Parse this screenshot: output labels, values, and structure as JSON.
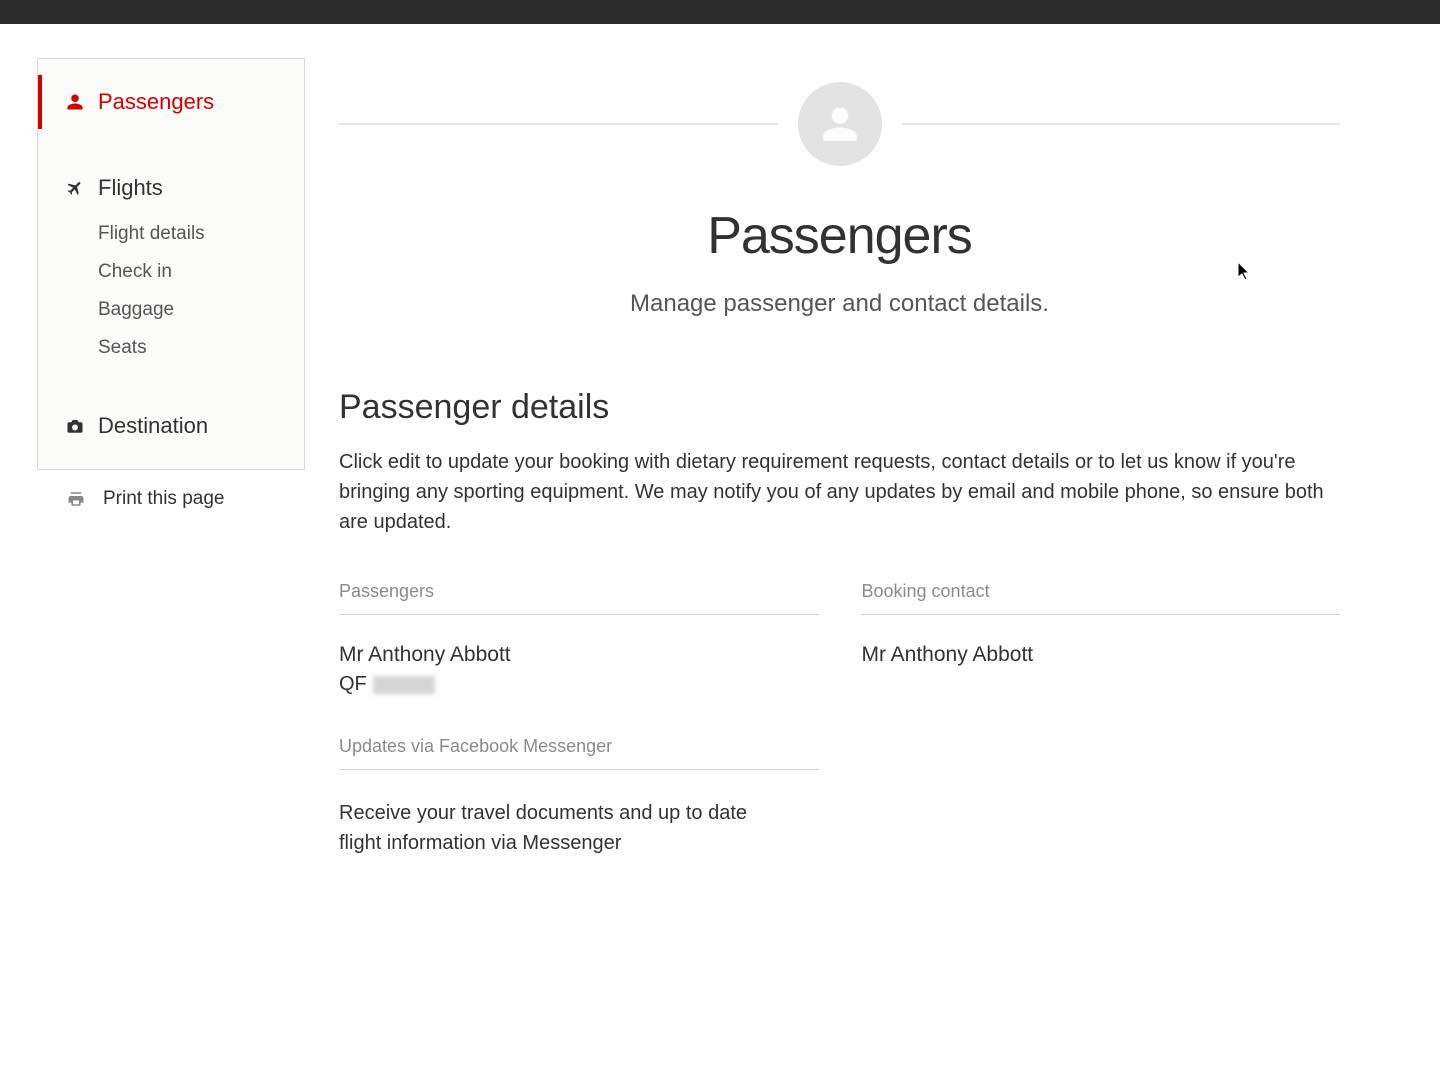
{
  "sidebar": {
    "passengers_label": "Passengers",
    "flights_label": "Flights",
    "flights_sub": {
      "flight_details": "Flight details",
      "check_in": "Check in",
      "baggage": "Baggage",
      "seats": "Seats"
    },
    "destination_label": "Destination",
    "print_label": "Print this page"
  },
  "main": {
    "title": "Passengers",
    "subtitle": "Manage passenger and contact details.",
    "section_title": "Passenger details",
    "section_desc": "Click edit to update your booking with dietary requirement requests, contact details or to let us know if you're bringing any sporting equipment. We may notify you of any updates by email and mobile phone, so ensure both are updated.",
    "passengers_header": "Passengers",
    "booking_contact_header": "Booking contact",
    "passenger_name": "Mr Anthony Abbott",
    "passenger_code_prefix": "QF",
    "booking_contact_name": "Mr Anthony Abbott",
    "messenger_header": "Updates via Facebook Messenger",
    "messenger_desc": "Receive your travel documents and up to date flight information via Messenger"
  }
}
